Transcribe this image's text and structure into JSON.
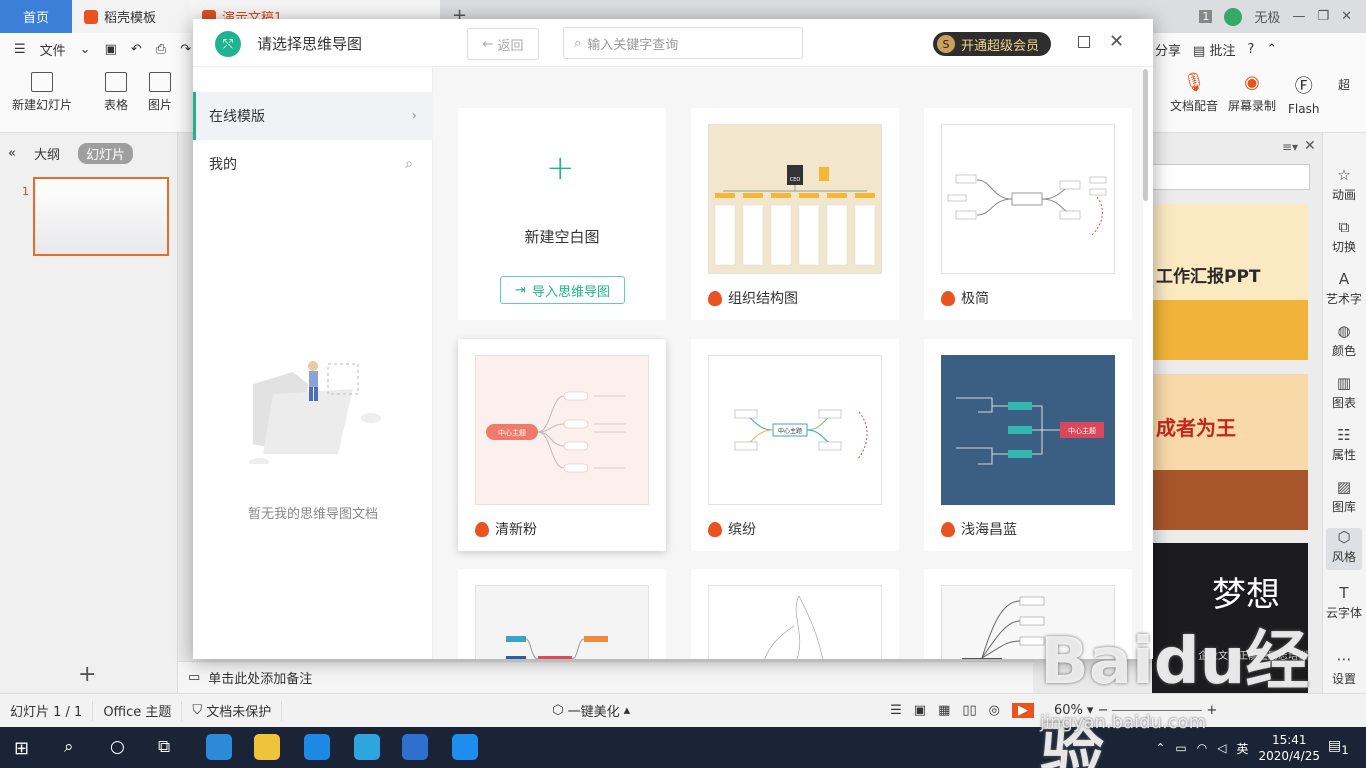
{
  "tabs": {
    "home": "首页",
    "docer": "稻壳模板",
    "ppt": "演示文稿1"
  },
  "titlebar": {
    "user": "无极",
    "badge": "1"
  },
  "menu": {
    "file": "文件"
  },
  "ribbon": {
    "new_slide": "新建幻灯片",
    "table": "表格",
    "picture": "图片",
    "share": "分享",
    "comment": "批注",
    "doc_audio": "文档配音",
    "screen_rec": "屏幕录制",
    "flash": "Flash",
    "more": "超"
  },
  "left_panel": {
    "outline": "大纲",
    "slides": "幻灯片",
    "slide_number": "1"
  },
  "right_sidebar": [
    "动画",
    "切换",
    "艺术字",
    "颜色",
    "图表",
    "属性",
    "图库",
    "风格",
    "云字体",
    "设置"
  ],
  "templates": {
    "t1": "工作汇报PPT",
    "t2": "成者为王",
    "t3": "梦想",
    "t3_sub": "企业文化正能量励志培训"
  },
  "notes": {
    "placeholder": "单击此处添加备注"
  },
  "status": {
    "slide": "幻灯片 1 / 1",
    "theme": "Office 主题",
    "protect": "文档未保护",
    "beautify": "一键美化",
    "zoom": "60%"
  },
  "taskbar": {
    "time": "15:41",
    "date": "2020/4/25",
    "notif": "1"
  },
  "dialog": {
    "title": "请选择思维导图",
    "back": "返回",
    "search_placeholder": "输入关键字查询",
    "vip": "开通超级会员",
    "nav": {
      "online": "在线模版",
      "mine": "我的"
    },
    "empty": "暂无我的思维导图文档",
    "new_blank": "新建空白图",
    "import": "导入思维导图",
    "cards": [
      "组织结构图",
      "极简",
      "清新粉",
      "缤纷",
      "浅海昌蓝"
    ],
    "thumb_texts": {
      "ceo": "CEO",
      "center": "中心主题"
    }
  },
  "watermark": {
    "brand": "Baidu经验",
    "url": "jingyan.baidu.com"
  }
}
